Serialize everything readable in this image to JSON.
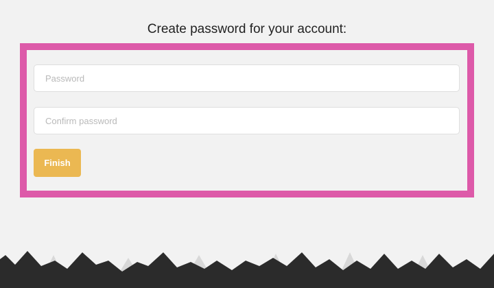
{
  "page": {
    "heading": "Create password for your account:"
  },
  "form": {
    "password_placeholder": "Password",
    "confirm_placeholder": "Confirm password",
    "finish_label": "Finish"
  },
  "colors": {
    "background": "#f2f2f2",
    "highlight_border": "#dd5aa9",
    "button": "#ebb852",
    "mountains_dark": "#2b2b2b",
    "mountains_light": "#d6d6d6"
  }
}
